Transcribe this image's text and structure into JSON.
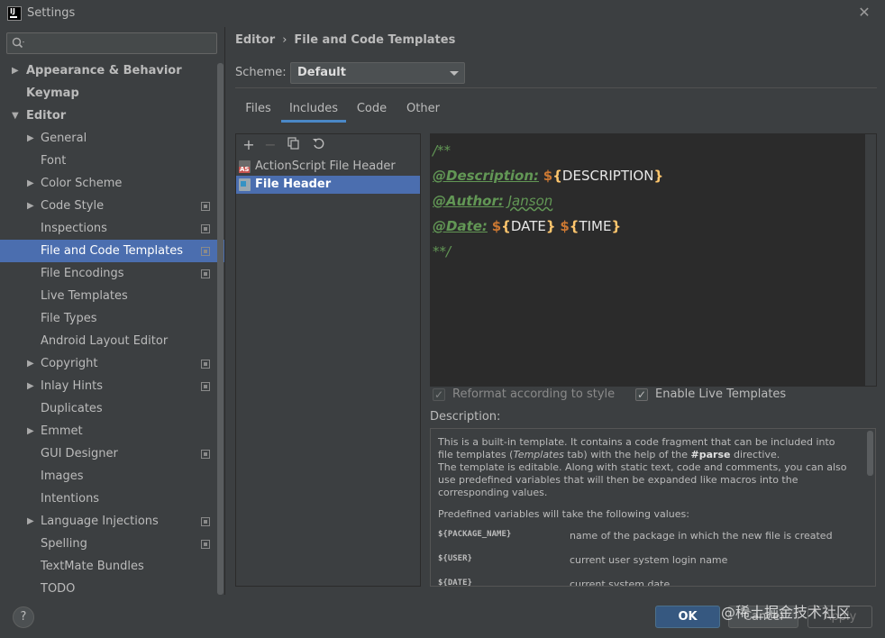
{
  "window": {
    "title": "Settings",
    "logo_text": "IJ"
  },
  "search": {
    "placeholder": "",
    "value": ""
  },
  "tree": [
    {
      "label": "Appearance & Behavior",
      "level": 0,
      "arrow": "right",
      "bold": true
    },
    {
      "label": "Keymap",
      "level": 0,
      "arrow": "none",
      "bold": true
    },
    {
      "label": "Editor",
      "level": 0,
      "arrow": "down",
      "bold": true
    },
    {
      "label": "General",
      "level": 1,
      "arrow": "right"
    },
    {
      "label": "Font",
      "level": 1,
      "arrow": "none"
    },
    {
      "label": "Color Scheme",
      "level": 1,
      "arrow": "right"
    },
    {
      "label": "Code Style",
      "level": 1,
      "arrow": "right",
      "project_icon": true
    },
    {
      "label": "Inspections",
      "level": 1,
      "arrow": "none",
      "project_icon": true
    },
    {
      "label": "File and Code Templates",
      "level": 1,
      "arrow": "none",
      "project_icon": true,
      "selected": true
    },
    {
      "label": "File Encodings",
      "level": 1,
      "arrow": "none",
      "project_icon": true
    },
    {
      "label": "Live Templates",
      "level": 1,
      "arrow": "none"
    },
    {
      "label": "File Types",
      "level": 1,
      "arrow": "none"
    },
    {
      "label": "Android Layout Editor",
      "level": 1,
      "arrow": "none"
    },
    {
      "label": "Copyright",
      "level": 1,
      "arrow": "right",
      "project_icon": true
    },
    {
      "label": "Inlay Hints",
      "level": 1,
      "arrow": "right",
      "project_icon": true
    },
    {
      "label": "Duplicates",
      "level": 1,
      "arrow": "none"
    },
    {
      "label": "Emmet",
      "level": 1,
      "arrow": "right"
    },
    {
      "label": "GUI Designer",
      "level": 1,
      "arrow": "none",
      "project_icon": true
    },
    {
      "label": "Images",
      "level": 1,
      "arrow": "none"
    },
    {
      "label": "Intentions",
      "level": 1,
      "arrow": "none"
    },
    {
      "label": "Language Injections",
      "level": 1,
      "arrow": "right",
      "project_icon": true
    },
    {
      "label": "Spelling",
      "level": 1,
      "arrow": "none",
      "project_icon": true
    },
    {
      "label": "TextMate Bundles",
      "level": 1,
      "arrow": "none"
    },
    {
      "label": "TODO",
      "level": 1,
      "arrow": "none"
    }
  ],
  "breadcrumb": {
    "parent": "Editor",
    "separator": "›",
    "current": "File and Code Templates"
  },
  "scheme": {
    "label": "Scheme:",
    "value": "Default"
  },
  "tabs": [
    {
      "label": "Files",
      "active": false
    },
    {
      "label": "Includes",
      "active": true
    },
    {
      "label": "Code",
      "active": false
    },
    {
      "label": "Other",
      "active": false
    }
  ],
  "template_list": [
    {
      "label": "ActionScript File Header",
      "icon": "actionscript-file-icon",
      "selected": false
    },
    {
      "label": "File Header",
      "icon": "java-file-icon",
      "selected": true
    }
  ],
  "editor": {
    "line1": "/**",
    "desc_tag": "@Description:",
    "desc_dollar": "$",
    "desc_open": "{",
    "desc_var": "DESCRIPTION",
    "desc_close": "}",
    "author_tag": "@Author:",
    "author_value": "Janson",
    "date_tag": "@Date:",
    "date_dollar": "$",
    "date_open": "{",
    "date_var": "DATE",
    "date_close": "}",
    "time_dollar": "$",
    "time_open": "{",
    "time_var": "TIME",
    "time_close": "}",
    "line5": "**/"
  },
  "options": {
    "reformat_label": "Reformat according to style",
    "reformat_checked": true,
    "reformat_enabled": false,
    "live_label": "Enable Live Templates",
    "live_checked": true
  },
  "description": {
    "label": "Description:",
    "p1_a": "This is a built-in template. It contains a code fragment that can be included into file templates (",
    "p1_em": "Templates",
    "p1_b": " tab) with the help of the ",
    "p1_strong": "#parse",
    "p1_c": " directive.",
    "p1_line2": "The template is editable. Along with static text, code and comments, you can also use predefined variables that will then be expanded like macros into the corresponding values.",
    "p2": "Predefined variables will take the following values:",
    "vars": [
      {
        "name": "${PACKAGE_NAME}",
        "desc": "name of the package in which the new file is created"
      },
      {
        "name": "${USER}",
        "desc": "current user system login name"
      },
      {
        "name": "${DATE}",
        "desc": "current system date"
      }
    ]
  },
  "buttons": {
    "ok": "OK",
    "cancel": "Cancel",
    "apply": "Apply",
    "help": "?"
  },
  "watermark": "@稀土掘金技术社区"
}
